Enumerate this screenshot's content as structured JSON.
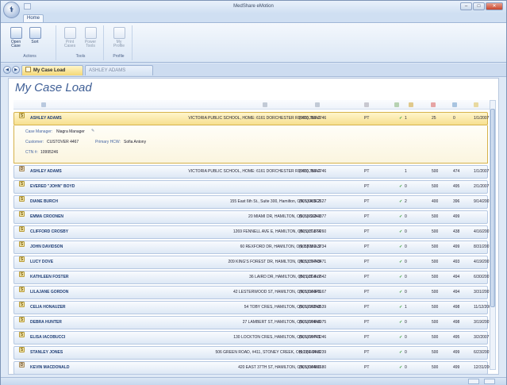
{
  "window": {
    "title": "MedShare eMotion"
  },
  "ribbon": {
    "tab": "Home",
    "groups": [
      {
        "label": "Actions",
        "buttons": [
          "Open Case",
          "Sort"
        ]
      },
      {
        "label": "Tools",
        "buttons": [
          "Print Cases",
          "Power Tools"
        ]
      },
      {
        "label": "Profile",
        "buttons": [
          "My Profile"
        ]
      }
    ]
  },
  "tabs": {
    "active": "My Case Load",
    "inactive": "ASHLEY ADAMS"
  },
  "page": {
    "title": "My Case Load"
  },
  "expanded": {
    "case_manager_label": "Case Manager:",
    "case_manager": "Niagra Manager",
    "customer_label": "Customer:",
    "customer": "CUSTOVER 4467",
    "primary_hcw_label": "Primary HCW:",
    "primary_hcw": "Sofia Antony",
    "ctn_label": "CTN #:",
    "ctn": "10995246"
  },
  "rows": [
    {
      "name": "ASHLEY ADAMS",
      "addr": "VICTORIA PUBLIC SCHOOL, HOME: 6161 DORCHESTER RD #10, NIAG",
      "phone": "(905) 356-2746",
      "type": "PT",
      "chk": "✓",
      "n1": "1",
      "n2": "25",
      "n3": "0",
      "date": "1/1/2007",
      "icon": "S",
      "selected": true
    },
    {
      "name": "ASHLEY ADAMS",
      "addr": "VICTORIA PUBLIC SCHOOL, HOME: 6161 DORCHESTER RD #10, NIAG",
      "phone": "(905) 356-2746",
      "type": "PT",
      "chk": "",
      "n1": "1",
      "n2": "500",
      "n3": "474",
      "date": "1/1/2007",
      "icon": "D"
    },
    {
      "name": "EVERED \"JOHN\" BOYD",
      "addr": "",
      "phone": "",
      "type": "PT",
      "chk": "✓",
      "n1": "0",
      "n2": "500",
      "n3": "495",
      "date": "2/1/2007",
      "icon": "S"
    },
    {
      "name": "DIANE BURCH",
      "addr": "155 East 6th St., Suite 300, Hamilton, ON, L8A 3C3",
      "phone": "(905) 389-2627",
      "type": "PT",
      "chk": "✓",
      "n1": "2",
      "n2": "400",
      "n3": "396",
      "date": "9/14/2007",
      "icon": "S"
    },
    {
      "name": "EMMA CROONEN",
      "addr": "20 MIAMI DR, HAMILTON, ON, L8C-2K3",
      "phone": "(905) 383-4377",
      "type": "PT",
      "chk": "✓",
      "n1": "0",
      "n2": "500",
      "n3": "499",
      "date": "",
      "icon": "S"
    },
    {
      "name": "CLIFFORD CROSBY",
      "addr": "1269 FENNELL AVE E, HAMILTON, ON, L8T-1T4",
      "phone": "(905) 318-9260",
      "type": "PT",
      "chk": "✓",
      "n1": "0",
      "n2": "500",
      "n3": "438",
      "date": "4/16/2007",
      "icon": "S"
    },
    {
      "name": "JOHN DAVIDSON",
      "addr": "60 REXFORD DR, HAMILTON, ON, L8W-2L9",
      "phone": "(905) 389-3734",
      "type": "PT",
      "chk": "✓",
      "n1": "0",
      "n2": "500",
      "n3": "499",
      "date": "8/31/2007",
      "icon": "S"
    },
    {
      "name": "LUCY DOVE",
      "addr": "209 KING'S FOREST DR, HAMILTON, ON, L8T-4K3",
      "phone": "(905) 387-8471",
      "type": "PT",
      "chk": "✓",
      "n1": "0",
      "n2": "500",
      "n3": "493",
      "date": "4/19/2007",
      "icon": "S"
    },
    {
      "name": "KATHLEEN FOSTER",
      "addr": "36 LAIRD DR, HAMILTON, ON, L8T-4L7",
      "phone": "(905) 318-6842",
      "type": "PT",
      "chk": "✓",
      "n1": "0",
      "n2": "500",
      "n3": "494",
      "date": "6/30/2007",
      "icon": "S"
    },
    {
      "name": "LILAJANE GORDON",
      "addr": "42 LESTERWOOD ST, HAMILTON, ON, L8V-4P5",
      "phone": "(905) 383-9167",
      "type": "PT",
      "chk": "✓",
      "n1": "0",
      "n2": "500",
      "n3": "494",
      "date": "3/31/2007",
      "icon": "S"
    },
    {
      "name": "CELIA HONAUZER",
      "addr": "54 TOBY CRES, HAMILTON, ON, L8V-2N8",
      "phone": "(905) 385-0539",
      "type": "PT",
      "chk": "✓",
      "n1": "1",
      "n2": "500",
      "n3": "498",
      "date": "11/12/2006",
      "icon": "S"
    },
    {
      "name": "DEBRA HUNTER",
      "addr": "27 LAMBERT ST, HAMILTON, ON, L8V-4N6",
      "phone": "(905) 389-8975",
      "type": "PT",
      "chk": "✓",
      "n1": "0",
      "n2": "500",
      "n3": "498",
      "date": "3/19/2007",
      "icon": "S"
    },
    {
      "name": "ELISA IACOBUCCI",
      "addr": "130 LOCKTON CRES, HAMILTON, ON, L8V-4R1",
      "phone": "(905) 387-3246",
      "type": "PT",
      "chk": "✓",
      "n1": "0",
      "n2": "500",
      "n3": "495",
      "date": "3/2/2007",
      "icon": "S"
    },
    {
      "name": "STANLEY JONES",
      "addr": "506 GREEN ROAD, #411, STONEY CREEK, ON, L8E-3W6",
      "phone": "(905) 664-3239",
      "type": "PT",
      "chk": "✓",
      "n1": "0",
      "n2": "500",
      "n3": "499",
      "date": "6/23/2007",
      "icon": "S"
    },
    {
      "name": "KEVIN MACDONALD",
      "addr": "420 EAST 37TH ST, HAMILTON, ON, L8V-4B6",
      "phone": "(905) 385-1680",
      "type": "PT",
      "chk": "✓",
      "n1": "0",
      "n2": "500",
      "n3": "499",
      "date": "12/31/2006",
      "icon": "D"
    }
  ]
}
